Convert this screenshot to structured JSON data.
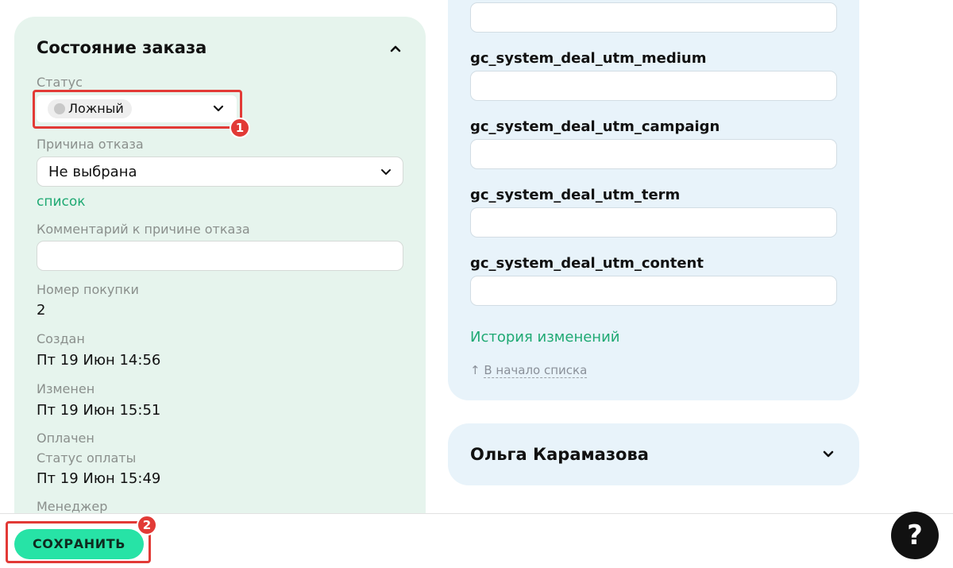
{
  "order_state": {
    "title": "Состояние заказа",
    "status_label": "Статус",
    "status_value": "Ложный",
    "reason_label": "Причина отказа",
    "reason_value": "Не выбрана",
    "list_link": "список",
    "comment_label": "Комментарий к причине отказа",
    "comment_value": "",
    "purchase_no_label": "Номер покупки",
    "purchase_no_value": "2",
    "created_label": "Создан",
    "created_value": "Пт 19 Июн 14:56",
    "modified_label": "Изменен",
    "modified_value": "Пт 19 Июн 15:51",
    "paid_label": "Оплачен",
    "payment_status_label": "Статус оплаты",
    "payment_status_value": "Пт 19 Июн 15:49",
    "manager_label": "Менеджер"
  },
  "utm_fields": [
    {
      "label": "gc_system_deal_utm_medium",
      "value": ""
    },
    {
      "label": "gc_system_deal_utm_campaign",
      "value": ""
    },
    {
      "label": "gc_system_deal_utm_term",
      "value": ""
    },
    {
      "label": "gc_system_deal_utm_content",
      "value": ""
    }
  ],
  "history_link": "История изменений",
  "to_top_arrow": "↑",
  "to_top_link": "В начало списка",
  "person": {
    "name": "Ольга Карамазова"
  },
  "bottom_bar": {
    "save_label": "СОХРАНИТЬ",
    "help_label": "?"
  },
  "annotations": {
    "badge_1": "1",
    "badge_2": "2"
  },
  "colors": {
    "left_card_bg": "#e6f4ed",
    "right_card_bg": "#e8f3fa",
    "accent_green": "#1fa973",
    "save_button": "#27e3a6",
    "highlight_red": "#e23a36"
  },
  "icons": {
    "collapse": "chevron-up-icon",
    "dropdown": "chevron-down-icon",
    "status_dot": "status-dot-icon",
    "help": "question-mark-icon"
  }
}
